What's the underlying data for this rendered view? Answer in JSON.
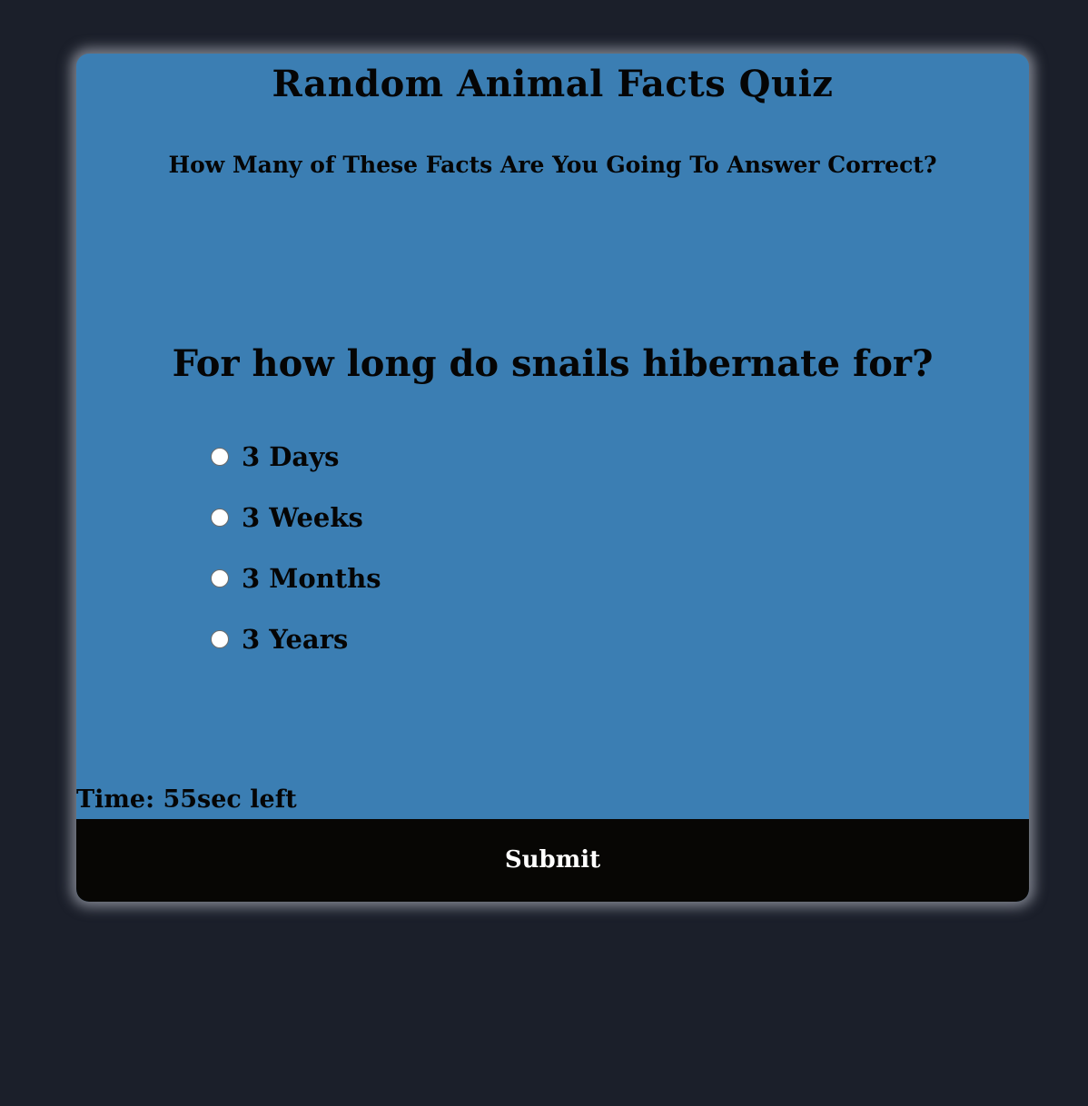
{
  "quiz": {
    "title": "Random Animal Facts Quiz",
    "subtitle": "How Many of These Facts Are You Going To Answer Correct?",
    "question": "For how long do snails hibernate for?",
    "options": [
      {
        "label": "3 Days"
      },
      {
        "label": "3 Weeks"
      },
      {
        "label": "3 Months"
      },
      {
        "label": "3 Years"
      }
    ],
    "timer_text": "Time: 55sec left",
    "submit_label": "Submit"
  },
  "colors": {
    "page_background": "#1b1f2a",
    "card_background": "#3b7eb3",
    "submit_background": "#070604",
    "text": "#050505",
    "submit_text": "#ffffff"
  }
}
